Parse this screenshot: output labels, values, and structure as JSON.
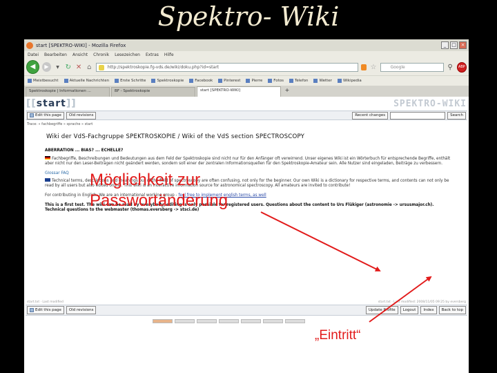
{
  "slide": {
    "title": "Spektro- Wiki"
  },
  "browser": {
    "window_title": "start [SPEKTRO-WIKI] - Mozilla Firefox",
    "menu": [
      "Datei",
      "Bearbeiten",
      "Ansicht",
      "Chronik",
      "Lesezeichen",
      "Extras",
      "Hilfe"
    ],
    "url": "http://spektroskopie.fg-vds.de/wiki/doku.php?id=start",
    "search_placeholder": "Google",
    "adblock_label": "ABP",
    "bookmarks": [
      "Meistbesucht",
      "Aktuelle Nachrichten",
      "Erste Schritte",
      "Spektroskopie",
      "Facebook",
      "Pinterest",
      "Pierre",
      "Fotos",
      "Telefon",
      "Wetter",
      "Wikipedia"
    ],
    "tabs": [
      {
        "label": "Spektroskopie | Informationen ...",
        "active": false
      },
      {
        "label": "BF - Spektroskopie",
        "active": false
      },
      {
        "label": "start [SPEKTRO-WIKI]",
        "active": true
      }
    ],
    "new_tab": "+"
  },
  "wiki": {
    "logo_left": "start",
    "logo_right": "SPEKTRO-WIKI",
    "top_buttons": {
      "edit": "Edit this page",
      "old": "Old revisions"
    },
    "recent_changes": "Recent changes",
    "search_button": "Search",
    "trace": "Trace: » fachbegriffe » sprache » start",
    "page_title": "Wiki der VdS-Fachgruppe SPEKTROSKOPIE / Wiki of the VdS section SPECTROSCOPY",
    "section": "ABERRATION ... BIAS? ... ECHELLE?",
    "para_de": "Fachbegriffe, Beschreibungen und Bedeutungen aus dem Feld der Spektroskopie sind nicht nur für den Anfänger oft verwirrend. Unser eigenes Wiki ist ein Wörterbuch für entsprechende Begriffe, enthält aber nicht nur den Leser-Beiträgen nicht geändert werden, sondern soll einer der zentralen Informationsquellen für den Spektroskopie-Amateur sein. Alle Nutzer sind eingeladen, Beiträge zu verbessern.",
    "glossar": "Glossar FAQ",
    "para_en": "Technical terms, descriptions and meanings out of the field of spectroscopy are often confusing, not only for the beginner. Our own Wiki is a dictionary for respective terms, and contents can not only be read by all users but also edited online. This Wiki is an interactive information source for astronomical spectroscopy. All amateurs are invited to contribute!",
    "para_translate_pre": "For contributing in English: We are an international working group - ",
    "para_translate_link": "feel free to implement english terms, as well",
    "para_test": "This is a first test. The wiki can be read by everybody, editing is only possible for registered users. Questions about the content to Urs Flükiger (astronomie -> ursusmajor.ch). Technical questions to the webmaster (thomas.eversberg -> stsci.de)",
    "footer_left": "start.txt · Last modified",
    "footer_right": "start.txt · Last modified: 2008/11/05 09:25 by eversberg",
    "bottom_buttons": {
      "edit": "Edit this page",
      "old": "Old revisions",
      "update": "Update Profile",
      "logout": "Logout",
      "index": "Index",
      "back": "Back to top"
    }
  },
  "annotations": {
    "password_line1": "Möglichkeit zur",
    "password_line2": "Passwortänderung",
    "entry": "„Eintritt“",
    "color": "#e21b1b"
  }
}
